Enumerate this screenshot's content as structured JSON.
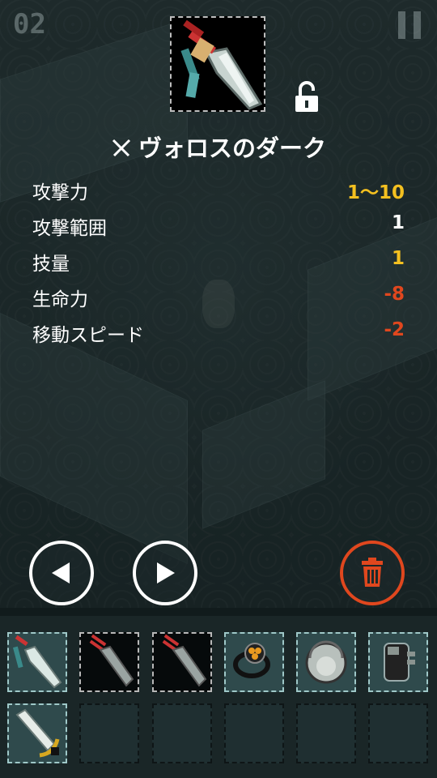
{
  "hud": {
    "level_number": "02"
  },
  "item": {
    "name": "ヴォロスのダーク",
    "icon": "dagger-icon",
    "lock_icon": "unlocked-padlock-icon",
    "category_icon": "crossed-swords-icon"
  },
  "stats": [
    {
      "label": "攻撃力",
      "value": "1～10",
      "color": "#f4c020"
    },
    {
      "label": "攻撃範囲",
      "value": "1",
      "color": "#ffffff"
    },
    {
      "label": "技量",
      "value": "1",
      "color": "#f4c020"
    },
    {
      "label": "生命力",
      "value": "-8",
      "color": "#e0471e"
    },
    {
      "label": "移動スピード",
      "value": "-2",
      "color": "#e0471e"
    }
  ],
  "controls": {
    "prev_icon": "left-arrow-icon",
    "next_icon": "right-arrow-icon",
    "delete_icon": "trash-icon"
  },
  "inventory": {
    "slots": [
      {
        "item": "dagger",
        "style": "light",
        "selected": true
      },
      {
        "item": "knife",
        "style": "dark"
      },
      {
        "item": "knife",
        "style": "dark"
      },
      {
        "item": "ring",
        "style": "light"
      },
      {
        "item": "helmet",
        "style": "light"
      },
      {
        "item": "gauntlet",
        "style": "light"
      },
      {
        "item": "sword",
        "style": "light"
      },
      {
        "item": "",
        "style": "empty"
      },
      {
        "item": "",
        "style": "empty"
      },
      {
        "item": "",
        "style": "empty"
      },
      {
        "item": "",
        "style": "empty"
      },
      {
        "item": "",
        "style": "empty"
      }
    ]
  },
  "colors": {
    "accent_gold": "#f4c020",
    "negative_red": "#e0471e",
    "text_white": "#ffffff"
  }
}
